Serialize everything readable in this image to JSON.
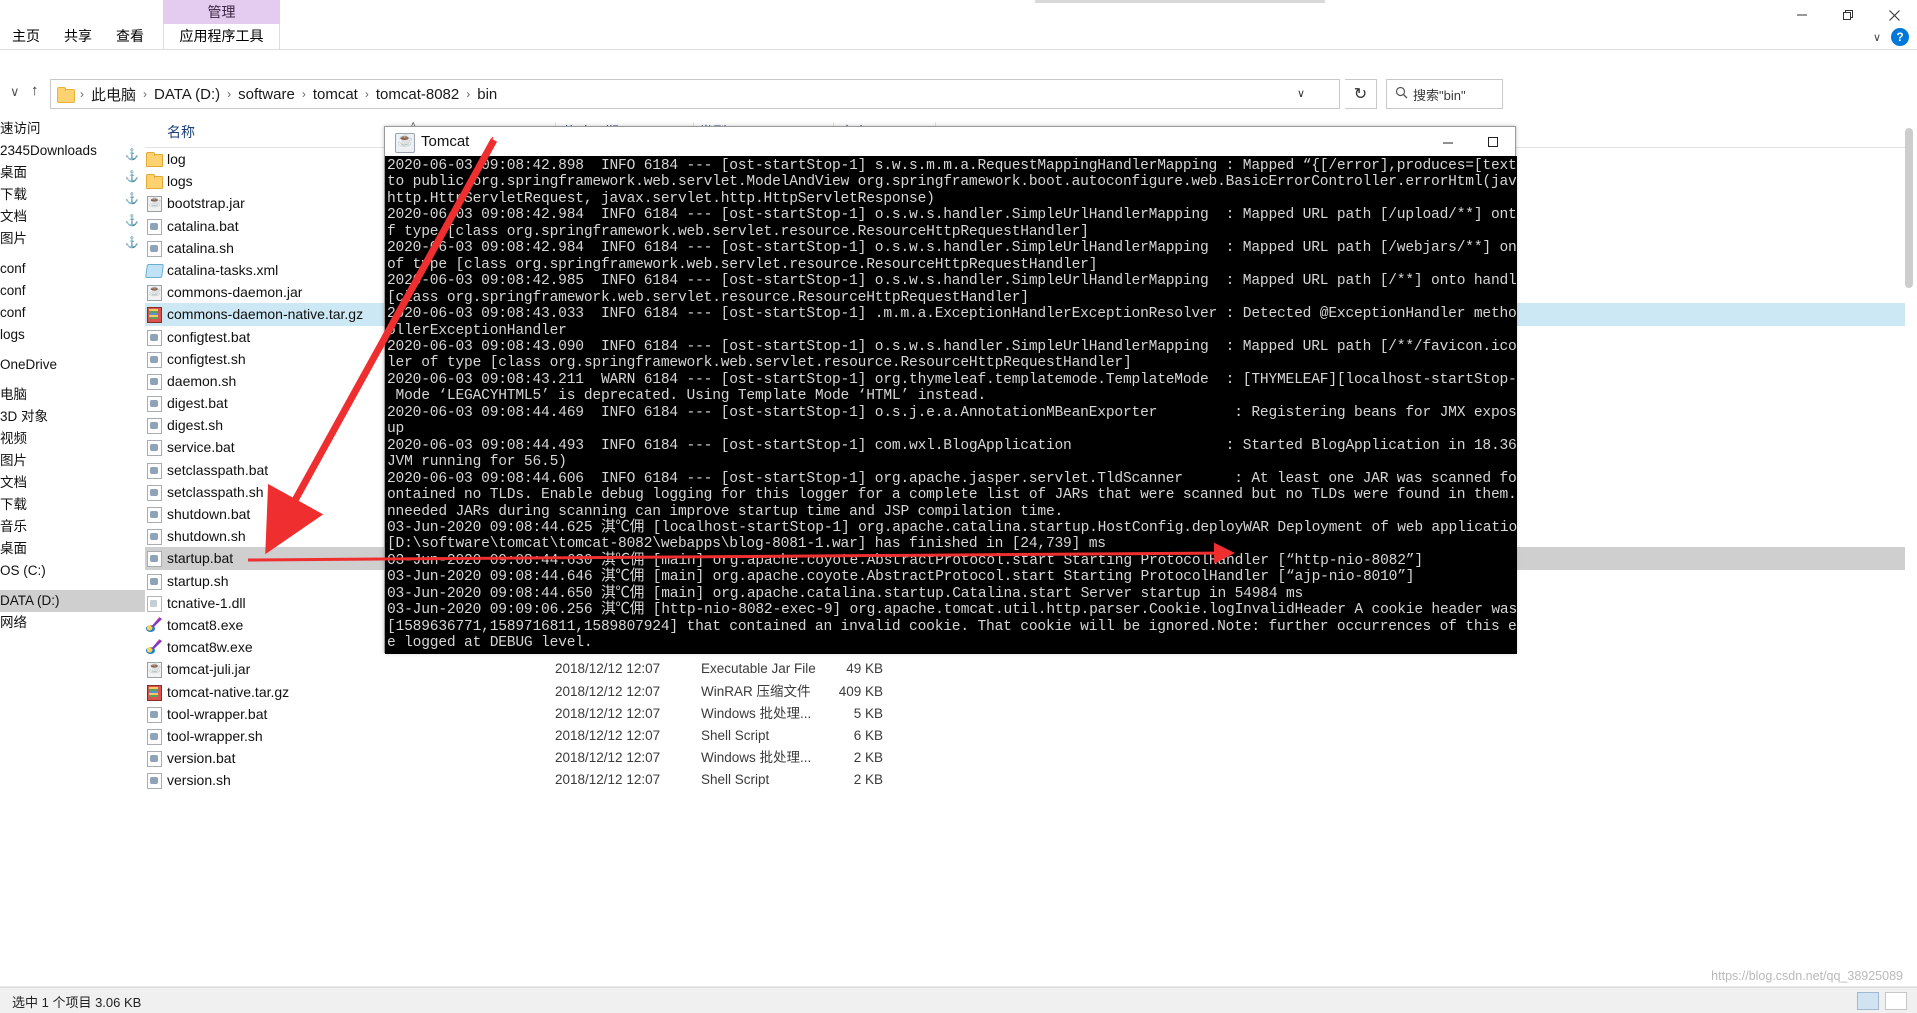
{
  "window": {
    "title": "Tomcat",
    "minimize_label": "—",
    "maximize_label": "□",
    "close_label": "✕"
  },
  "ribbon": {
    "contextual_tab_group": "管理",
    "tabs": [
      {
        "label": "主页"
      },
      {
        "label": "共享"
      },
      {
        "label": "查看"
      },
      {
        "label": "应用程序工具"
      }
    ],
    "help_label": "?",
    "collapse_label": "∨"
  },
  "addressbar": {
    "back_label": "∨",
    "up_label": "↑",
    "crumbs": [
      "此电脑",
      "DATA (D:)",
      "software",
      "tomcat",
      "tomcat-8082",
      "bin"
    ],
    "separator": "›",
    "dropdown_label": "∨",
    "refresh_label": "↻",
    "search_icon": "search-icon",
    "search_placeholder": "搜索\"bin\""
  },
  "navpane": {
    "items": [
      {
        "label": "速访问",
        "pinned": false,
        "selected": false
      },
      {
        "label": "2345Downloads",
        "pinned": true,
        "selected": false
      },
      {
        "label": "桌面",
        "pinned": true,
        "selected": false
      },
      {
        "label": "下载",
        "pinned": true,
        "selected": false
      },
      {
        "label": "文档",
        "pinned": true,
        "selected": false
      },
      {
        "label": "图片",
        "pinned": true,
        "selected": false
      },
      {
        "label": "conf",
        "pinned": false,
        "selected": false
      },
      {
        "label": "conf",
        "pinned": false,
        "selected": false
      },
      {
        "label": "conf",
        "pinned": false,
        "selected": false
      },
      {
        "label": "logs",
        "pinned": false,
        "selected": false
      },
      {
        "label": "OneDrive",
        "pinned": false,
        "selected": false
      },
      {
        "label": "电脑",
        "pinned": false,
        "selected": false
      },
      {
        "label": "3D 对象",
        "pinned": false,
        "selected": false
      },
      {
        "label": "视频",
        "pinned": false,
        "selected": false
      },
      {
        "label": "图片",
        "pinned": false,
        "selected": false
      },
      {
        "label": "文档",
        "pinned": false,
        "selected": false
      },
      {
        "label": "下载",
        "pinned": false,
        "selected": false
      },
      {
        "label": "音乐",
        "pinned": false,
        "selected": false
      },
      {
        "label": "桌面",
        "pinned": false,
        "selected": false
      },
      {
        "label": "OS (C:)",
        "pinned": false,
        "selected": false
      },
      {
        "label": "DATA (D:)",
        "pinned": false,
        "selected": true
      },
      {
        "label": "网络",
        "pinned": false,
        "selected": false
      }
    ]
  },
  "filelist": {
    "columns": {
      "name": "名称",
      "date": "修改日期",
      "type": "类型",
      "size": "大小"
    },
    "sort_caret": "˄",
    "rows": [
      {
        "name": "log",
        "icon": "folder-icon",
        "date": "",
        "type": "",
        "size": "",
        "state": "none"
      },
      {
        "name": "logs",
        "icon": "folder-icon",
        "date": "",
        "type": "",
        "size": "",
        "state": "none"
      },
      {
        "name": "bootstrap.jar",
        "icon": "jar-icon",
        "date": "",
        "type": "",
        "size": "",
        "state": "none"
      },
      {
        "name": "catalina.bat",
        "icon": "bat-icon",
        "date": "",
        "type": "",
        "size": "",
        "state": "none"
      },
      {
        "name": "catalina.sh",
        "icon": "bat-icon",
        "date": "",
        "type": "",
        "size": "",
        "state": "none"
      },
      {
        "name": "catalina-tasks.xml",
        "icon": "xml-icon",
        "date": "",
        "type": "",
        "size": "",
        "state": "none"
      },
      {
        "name": "commons-daemon.jar",
        "icon": "jar-icon",
        "date": "",
        "type": "",
        "size": "",
        "state": "none"
      },
      {
        "name": "commons-daemon-native.tar.gz",
        "icon": "rar-icon",
        "date": "",
        "type": "",
        "size": "",
        "state": "hover"
      },
      {
        "name": "configtest.bat",
        "icon": "bat-icon",
        "date": "",
        "type": "",
        "size": "",
        "state": "none"
      },
      {
        "name": "configtest.sh",
        "icon": "bat-icon",
        "date": "",
        "type": "",
        "size": "",
        "state": "none"
      },
      {
        "name": "daemon.sh",
        "icon": "bat-icon",
        "date": "",
        "type": "",
        "size": "",
        "state": "none"
      },
      {
        "name": "digest.bat",
        "icon": "bat-icon",
        "date": "",
        "type": "",
        "size": "",
        "state": "none"
      },
      {
        "name": "digest.sh",
        "icon": "bat-icon",
        "date": "",
        "type": "",
        "size": "",
        "state": "none"
      },
      {
        "name": "service.bat",
        "icon": "bat-icon",
        "date": "",
        "type": "",
        "size": "",
        "state": "none"
      },
      {
        "name": "setclasspath.bat",
        "icon": "bat-icon",
        "date": "",
        "type": "",
        "size": "",
        "state": "none"
      },
      {
        "name": "setclasspath.sh",
        "icon": "bat-icon",
        "date": "",
        "type": "",
        "size": "",
        "state": "none"
      },
      {
        "name": "shutdown.bat",
        "icon": "bat-icon",
        "date": "",
        "type": "",
        "size": "",
        "state": "none"
      },
      {
        "name": "shutdown.sh",
        "icon": "bat-icon",
        "date": "",
        "type": "",
        "size": "",
        "state": "none"
      },
      {
        "name": "startup.bat",
        "icon": "bat-icon",
        "date": "",
        "type": "",
        "size": "",
        "state": "selected"
      },
      {
        "name": "startup.sh",
        "icon": "bat-icon",
        "date": "",
        "type": "",
        "size": "",
        "state": "none"
      },
      {
        "name": "tcnative-1.dll",
        "icon": "dll-icon",
        "date": "",
        "type": "",
        "size": "",
        "state": "none"
      },
      {
        "name": "tomcat8.exe",
        "icon": "exe-icon",
        "date": "",
        "type": "",
        "size": "",
        "state": "none"
      },
      {
        "name": "tomcat8w.exe",
        "icon": "exe-icon",
        "date": "",
        "type": "",
        "size": "",
        "state": "none"
      },
      {
        "name": "tomcat-juli.jar",
        "icon": "jar-icon",
        "date": "2018/12/12 12:07",
        "type": "Executable Jar File",
        "size": "49 KB",
        "state": "none"
      },
      {
        "name": "tomcat-native.tar.gz",
        "icon": "rar-icon",
        "date": "2018/12/12 12:07",
        "type": "WinRAR 压缩文件",
        "size": "409 KB",
        "state": "none"
      },
      {
        "name": "tool-wrapper.bat",
        "icon": "bat-icon",
        "date": "2018/12/12 12:07",
        "type": "Windows 批处理...",
        "size": "5 KB",
        "state": "none"
      },
      {
        "name": "tool-wrapper.sh",
        "icon": "bat-icon",
        "date": "2018/12/12 12:07",
        "type": "Shell Script",
        "size": "6 KB",
        "state": "none"
      },
      {
        "name": "version.bat",
        "icon": "bat-icon",
        "date": "2018/12/12 12:07",
        "type": "Windows 批处理...",
        "size": "2 KB",
        "state": "none"
      },
      {
        "name": "version.sh",
        "icon": "bat-icon",
        "date": "2018/12/12 12:07",
        "type": "Shell Script",
        "size": "2 KB",
        "state": "none"
      }
    ]
  },
  "console": {
    "log": "2020-06-03 09:08:42.898  INFO 6184 --- [ost-startStop-1] s.w.s.m.m.a.RequestMappingHandlerMapping : Mapped “{[/error],produces=[text/html]\nto public org.springframework.web.servlet.ModelAndView org.springframework.boot.autoconfigure.web.BasicErrorController.errorHtml(javax.ser\nhttp.HttpServletRequest, javax.servlet.http.HttpServletResponse)\n2020-06-03 09:08:42.984  INFO 6184 --- [ost-startStop-1] o.s.w.s.handler.SimpleUrlHandlerMapping  : Mapped URL path [/upload/**] onto hand\nf type [class org.springframework.web.servlet.resource.ResourceHttpRequestHandler]\n2020-06-03 09:08:42.984  INFO 6184 --- [ost-startStop-1] o.s.w.s.handler.SimpleUrlHandlerMapping  : Mapped URL path [/webjars/**] onto handler\nof type [class org.springframework.web.servlet.resource.ResourceHttpRequestHandler]\n2020-06-03 09:08:42.985  INFO 6184 --- [ost-startStop-1] o.s.w.s.handler.SimpleUrlHandlerMapping  : Mapped URL path [/**] onto handler of type\n[class org.springframework.web.servlet.resource.ResourceHttpRequestHandler]\n2020-06-03 09:08:43.033  INFO 6184 --- [ost-startStop-1] .m.m.a.ExceptionHandlerExceptionResolver : Detected @ExceptionHandler methods in contr\nollerExceptionHandler\n2020-06-03 09:08:43.090  INFO 6184 --- [ost-startStop-1] o.s.w.s.handler.SimpleUrlHandlerMapping  : Mapped URL path [/**/favicon.ico] onto hand\nler of type [class org.springframework.web.servlet.resource.ResourceHttpRequestHandler]\n2020-06-03 09:08:43.211  WARN 6184 --- [ost-startStop-1] org.thymeleaf.templatemode.TemplateMode  : [THYMELEAF][localhost-startStop-1] Template\n Mode ‘LEGACYHTML5’ is deprecated. Using Template Mode ‘HTML’ instead.\n2020-06-03 09:08:44.469  INFO 6184 --- [ost-startStop-1] o.s.j.e.a.AnnotationMBeanExporter         : Registering beans for JMX exposure on start\nup\n2020-06-03 09:08:44.493  INFO 6184 --- [ost-startStop-1] com.wxl.BlogApplication                  : Started BlogApplication in 18.365 seconds (\nJVM running for 56.5)\n2020-06-03 09:08:44.606  INFO 6184 --- [ost-startStop-1] org.apache.jasper.servlet.TldScanner      : At least one JAR was scanned for TLDs yet c\nontained no TLDs. Enable debug logging for this logger for a complete list of JARs that were scanned but no TLDs were found in them. Skipping u\nnneeded JARs during scanning can improve startup time and JSP compilation time.\n03-Jun-2020 09:08:44.625 淇℃佣 [localhost-startStop-1] org.apache.catalina.startup.HostConfig.deployWAR Deployment of web application archive\n[D:\\software\\tomcat\\tomcat-8082\\webapps\\blog-8081-1.war] has finished in [24,739] ms\n03-Jun-2020 09:08:44.630 淇℃佣 [main] org.apache.coyote.AbstractProtocol.start Starting ProtocolHandler [“http-nio-8082”]\n03-Jun-2020 09:08:44.646 淇℃佣 [main] org.apache.coyote.AbstractProtocol.start Starting ProtocolHandler [“ajp-nio-8010”]\n03-Jun-2020 09:08:44.650 淇℃佣 [main] org.apache.catalina.startup.Catalina.start Server startup in 54984 ms\n03-Jun-2020 09:09:06.256 淇℃佣 [http-nio-8082-exec-9] org.apache.tomcat.util.http.parser.Cookie.logInvalidHeader A cookie header was received\n[1589636771,1589716811,1589807924] that contained an invalid cookie. That cookie will be ignored.Note: further occurrences of this error will b\ne logged at DEBUG level."
  },
  "statusbar": {
    "text": "选中 1 个项目  3.06 KB"
  },
  "watermark": {
    "text": "https://blog.csdn.net/qq_38925089"
  },
  "annotations": {
    "arrow_color": "#ef2f2f",
    "arrow1_target": "startup.bat",
    "arrow2_target": "http-nio-8082"
  }
}
